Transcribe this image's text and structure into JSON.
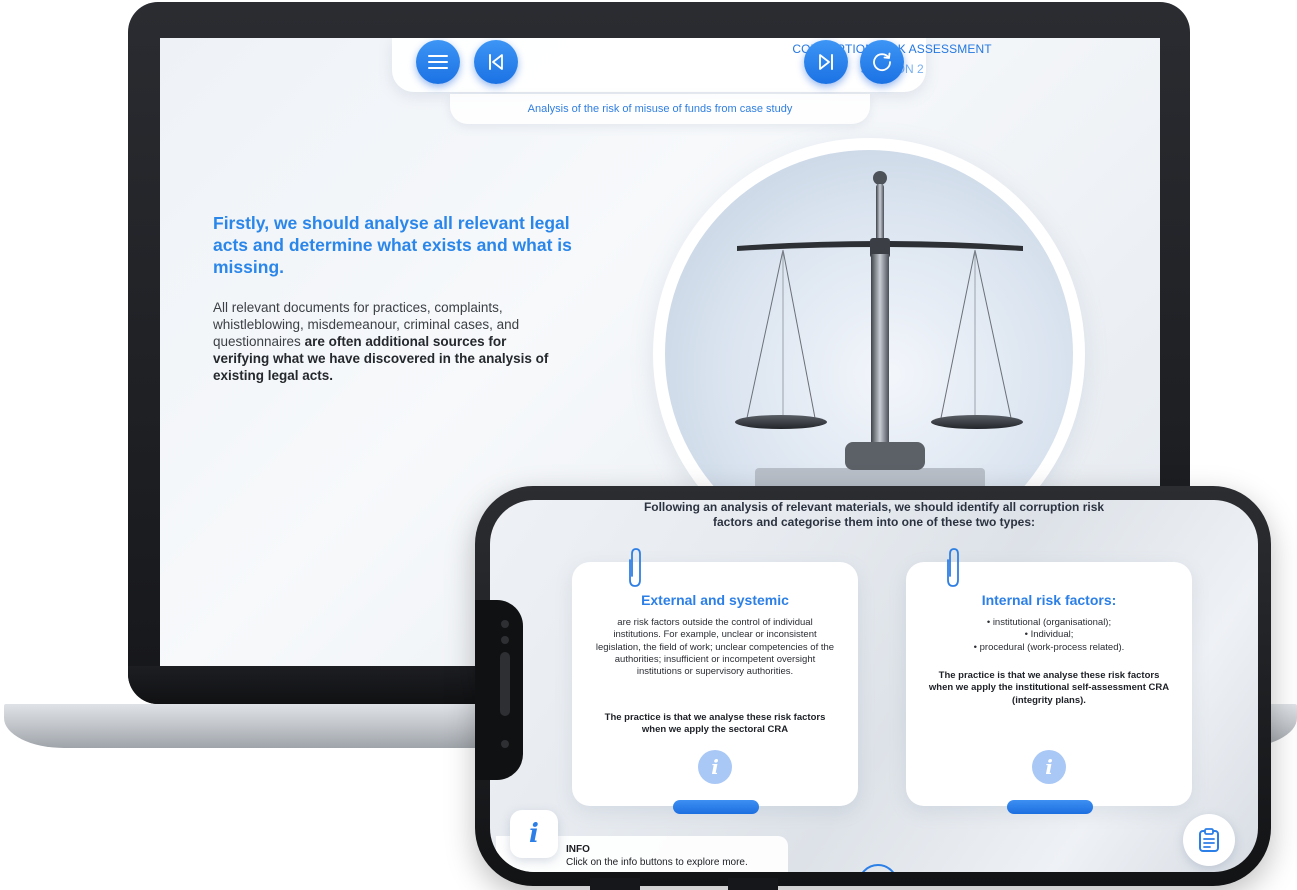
{
  "laptop": {
    "header": {
      "title": "CORRUPTION RISK ASSESSMENT",
      "session": "SESSION 2",
      "subtitle": "Analysis of the risk of misuse of funds from case study",
      "buttons": [
        "menu-icon",
        "skip-back-icon",
        "skip-forward-icon",
        "restart-icon"
      ]
    },
    "heading": "Firstly, we should analyse all relevant legal acts and determine what exists and what is missing.",
    "body_regular": "All relevant documents for practices, complaints, whistleblowing, misdemeanour, criminal cases, and questionnaires ",
    "body_bold": "are often additional sources for verifying what we have discovered in the analysis of existing legal acts.",
    "image": "scales-of-justice-with-gavel"
  },
  "phone": {
    "intro": "Following an analysis of relevant materials, we should identify all corruption risk factors and categorise them into one of these two types:",
    "cards": [
      {
        "title": "External and systemic",
        "body": "are risk factors outside the control of individual institutions. For example, unclear or inconsistent legislation, the field of work; unclear competencies of the authorities; insufficient or incompetent oversight institutions or supervisory authorities.",
        "practice": "The practice is that we analyse these risk factors when we apply the sectoral CRA",
        "info_glyph": "i"
      },
      {
        "title": "Internal risk factors:",
        "items": [
          "• institutional (organisational);",
          "• Individual;",
          "• procedural (work-process related)."
        ],
        "practice": "The practice is that we analyse these risk factors when we apply the institutional self-assessment CRA (integrity plans).",
        "info_glyph": "i"
      }
    ],
    "info": {
      "glyph": "i",
      "title": "INFO",
      "text": "Click on the info buttons to explore more."
    },
    "notes_icon": "clipboard-icon",
    "accent": "#2b7fe6"
  }
}
